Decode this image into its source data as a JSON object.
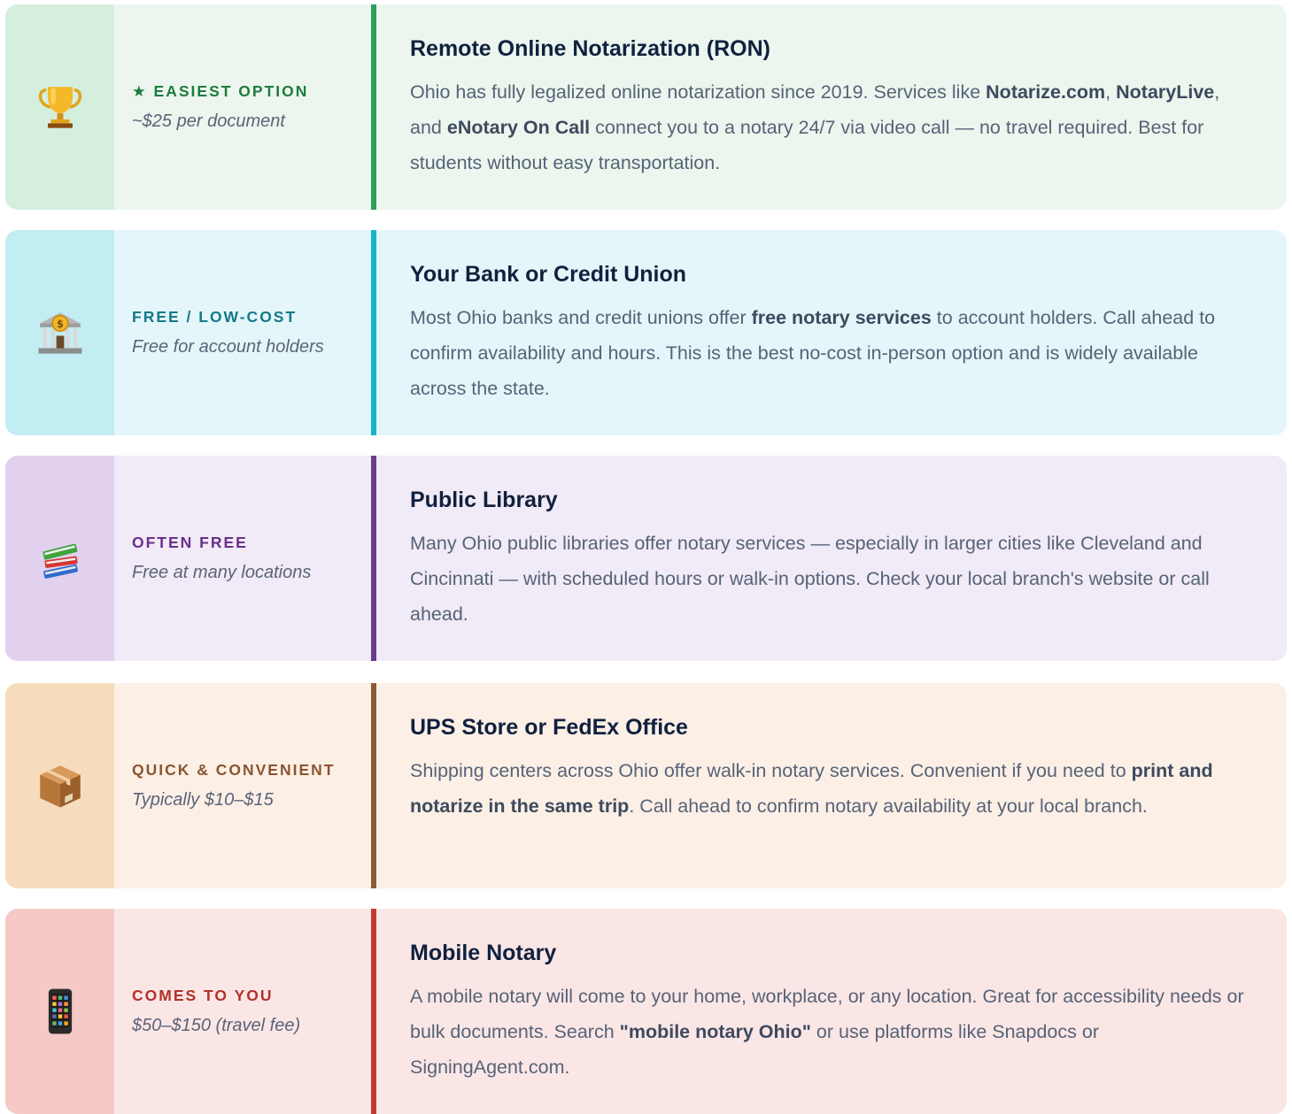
{
  "options": [
    {
      "icon": "trophy-icon",
      "tag": "★ EASIEST OPTION",
      "price": "~$25 per document",
      "title": "Remote Online Notarization (RON)",
      "desc": [
        {
          "t": "Ohio has fully legalized online notarization since 2019. Services like "
        },
        {
          "t": "Notarize.com",
          "b": true
        },
        {
          "t": ", "
        },
        {
          "t": "NotaryLive",
          "b": true
        },
        {
          "t": ", and "
        },
        {
          "t": "eNotary On Call",
          "b": true
        },
        {
          "t": " connect you to a notary 24/7 via video call — no travel required. Best for students without easy transportation."
        }
      ],
      "accent": "#2e9e5b"
    },
    {
      "icon": "bank-icon",
      "tag": "FREE / LOW-COST",
      "price": "Free for account holders",
      "title": "Your Bank or Credit Union",
      "desc": [
        {
          "t": "Most Ohio banks and credit unions offer "
        },
        {
          "t": "free notary services",
          "b": true
        },
        {
          "t": " to account holders. Call ahead to confirm availability and hours. This is the best no-cost in-person option and is widely available across the state."
        }
      ],
      "accent": "#17b4c9"
    },
    {
      "icon": "books-icon",
      "tag": "OFTEN FREE",
      "price": "Free at many locations",
      "title": "Public Library",
      "desc": [
        {
          "t": "Many Ohio public libraries offer notary services — especially in larger cities like Cleveland and Cincinnati — with scheduled hours or walk-in options. Check your local branch's website or call ahead."
        }
      ],
      "accent": "#6d3a8e"
    },
    {
      "icon": "package-icon",
      "tag": "QUICK & CONVENIENT",
      "price": "Typically $10–$15",
      "title": "UPS Store or FedEx Office",
      "desc": [
        {
          "t": "Shipping centers across Ohio offer walk-in notary services. Convenient if you need to "
        },
        {
          "t": "print and notarize in the same trip",
          "b": true
        },
        {
          "t": ". Call ahead to confirm notary availability at your local branch."
        }
      ],
      "accent": "#8c5a38"
    },
    {
      "icon": "mobile-phone-icon",
      "tag": "COMES TO YOU",
      "price": "$50–$150 (travel fee)",
      "title": "Mobile Notary",
      "desc": [
        {
          "t": "A mobile notary will come to your home, workplace, or any location. Great for accessibility needs or bulk documents. Search "
        },
        {
          "t": "\"mobile notary Ohio\"",
          "b": true
        },
        {
          "t": " or use platforms like Snapdocs or SigningAgent.com."
        }
      ],
      "accent": "#c33a33"
    }
  ]
}
